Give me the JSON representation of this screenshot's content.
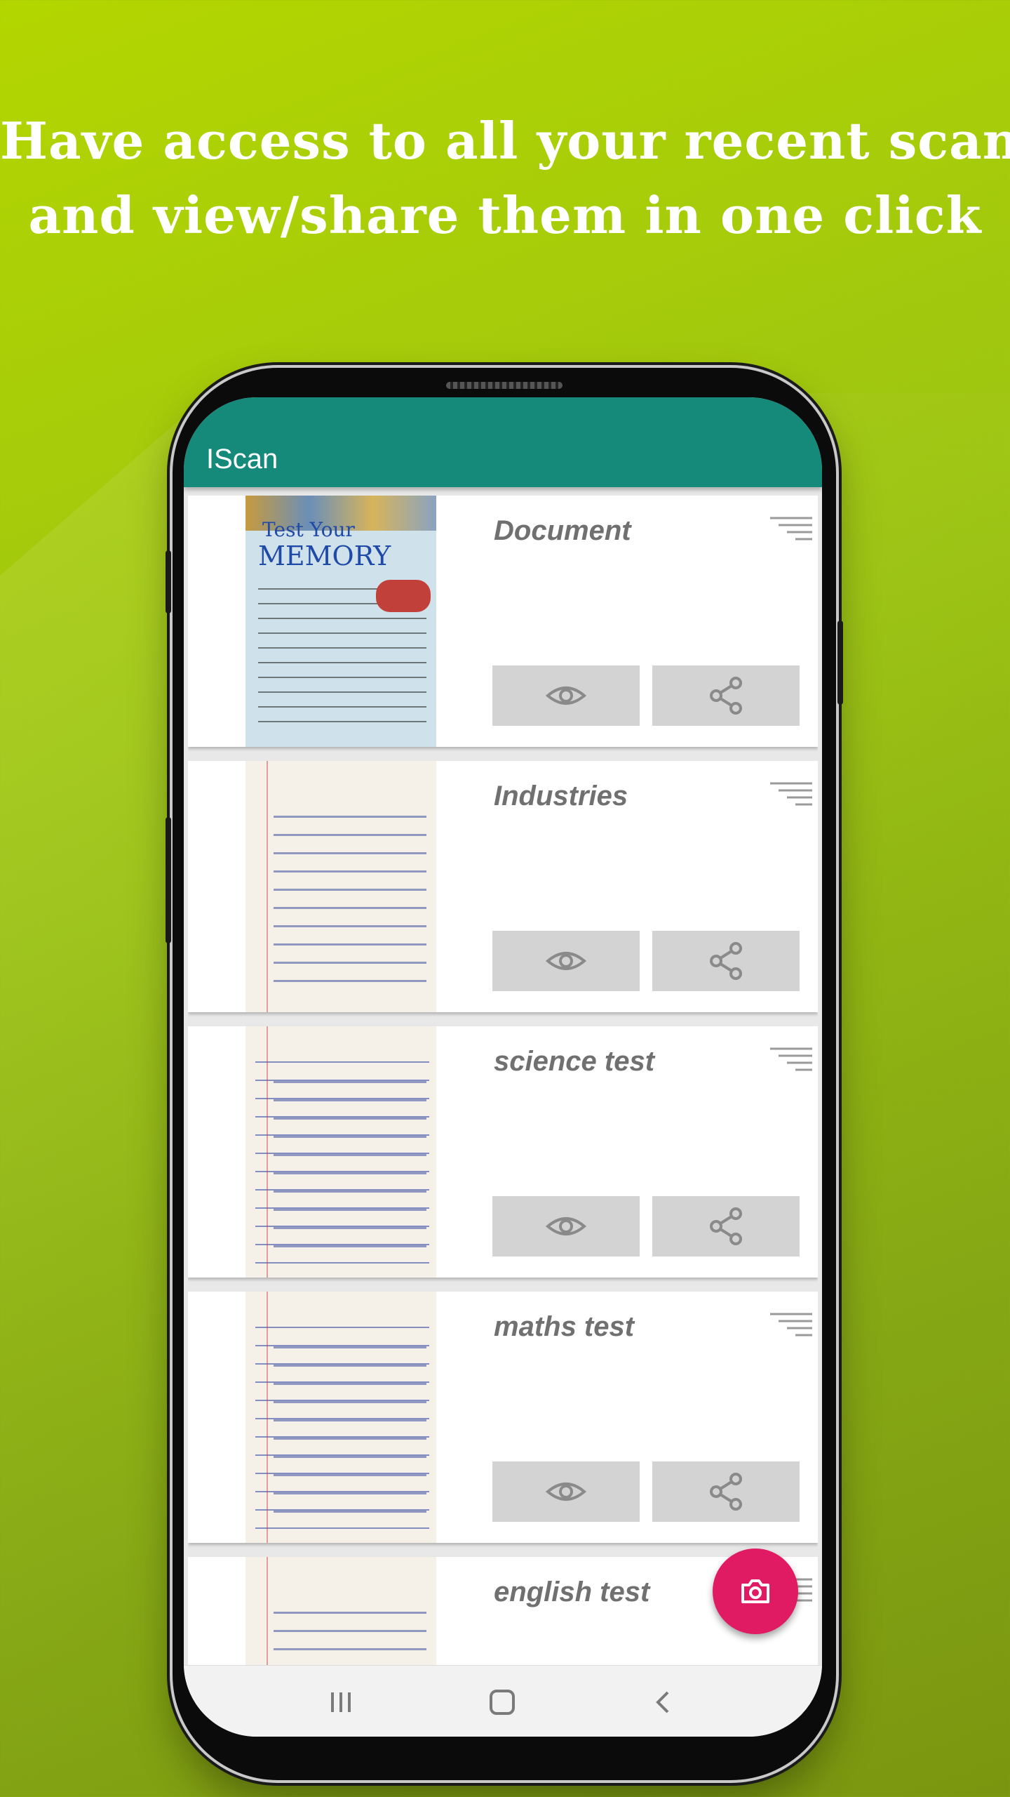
{
  "headline": {
    "line1": "Have access to all your recent scans",
    "line2": "and view/share them in one click"
  },
  "app": {
    "title": "IScan"
  },
  "thumbnail_book": {
    "line1": "Test Your",
    "line2": "MEMORY"
  },
  "scans": [
    {
      "title": "Document"
    },
    {
      "title": "Industries"
    },
    {
      "title": "science test"
    },
    {
      "title": "maths test"
    },
    {
      "title": "english test"
    }
  ],
  "icons": {
    "sort": "sort-lines-icon",
    "view": "eye-icon",
    "share": "share-icon",
    "fab": "camera-icon",
    "nav_recents": "recents-icon",
    "nav_home": "home-icon",
    "nav_back": "back-icon"
  },
  "colors": {
    "appbar": "#15897a",
    "fab": "#e01a63",
    "button": "#d3d3d3",
    "background": "#9cc412"
  }
}
